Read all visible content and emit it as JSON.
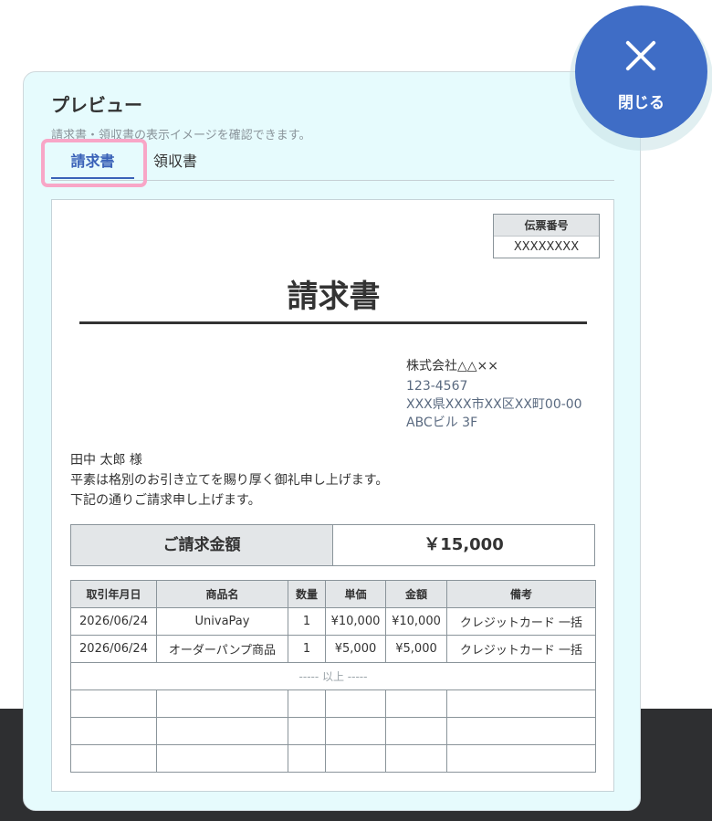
{
  "panel": {
    "title": "プレビュー",
    "subtitle": "請求書・領収書の表示イメージを確認できます。"
  },
  "tabs": [
    {
      "label": "請求書",
      "active": true
    },
    {
      "label": "領収書",
      "active": false
    }
  ],
  "close": {
    "label": "閉じる",
    "icon": "close-icon"
  },
  "document": {
    "slip_label": "伝票番号",
    "slip_value": "XXXXXXXX",
    "title": "請求書",
    "issuer": {
      "company": "株式会社△△××",
      "postal": "123-4567",
      "address": "XXX県XXX市XX区XX町00-00",
      "building": "ABCビル 3F"
    },
    "greeting": {
      "recipient": "田中 太郎 様",
      "line1": "平素は格別のお引き立てを賜り厚く御礼申し上げます。",
      "line2": "下記の通りご請求申し上げます。"
    },
    "amount": {
      "label": "ご請求金額",
      "value": "￥15,000"
    },
    "table": {
      "headers": [
        "取引年月日",
        "商品名",
        "数量",
        "単価",
        "金額",
        "備考"
      ],
      "rows": [
        [
          "2026/06/24",
          "UnivaPay",
          "1",
          "¥10,000",
          "¥10,000",
          "クレジットカード 一括"
        ],
        [
          "2026/06/24",
          "オーダーパンプ商品",
          "1",
          "¥5,000",
          "¥5,000",
          "クレジットカード 一括"
        ]
      ],
      "end_label": "----- 以上 -----"
    }
  },
  "colors": {
    "accent": "#3a62b8",
    "close_button": "#3f6dc6",
    "panel_bg": "#e6fbfd",
    "highlight": "#f8a6c7"
  }
}
